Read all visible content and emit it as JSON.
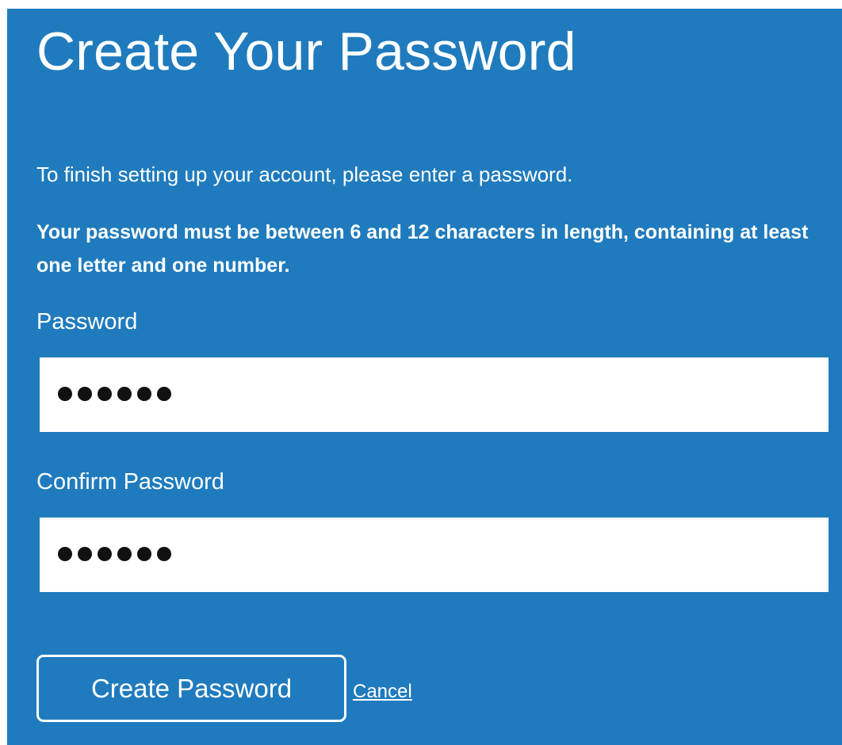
{
  "page": {
    "title": "Create Your Password",
    "intro": "To finish setting up your account, please enter a password.",
    "rules": "Your password must be between 6 and 12 characters in length, containing at least one letter and one number."
  },
  "form": {
    "password": {
      "label": "Password",
      "masked_char_count": 6
    },
    "confirm_password": {
      "label": "Confirm Password",
      "masked_char_count": 6
    }
  },
  "actions": {
    "submit_label": "Create Password",
    "cancel_label": "Cancel"
  },
  "colors": {
    "panel_background": "#1f7bbd",
    "text": "#ffffff",
    "input_background": "#ffffff",
    "mask_dot": "#111111"
  }
}
